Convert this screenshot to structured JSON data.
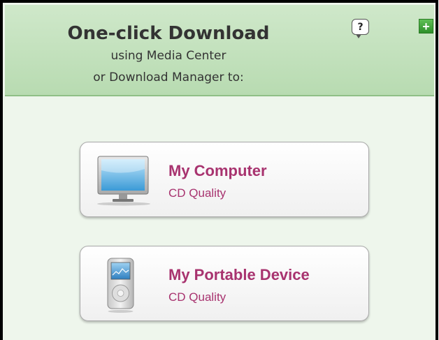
{
  "header": {
    "title": "One-click Download",
    "subtitle_line1": "using Media Center",
    "subtitle_line2": "or Download Manager to:",
    "help_label": "?",
    "expand_label": "+"
  },
  "options": [
    {
      "label": "My Computer",
      "quality": "CD Quality",
      "icon": "monitor-icon"
    },
    {
      "label": "My Portable Device",
      "quality": "CD Quality",
      "icon": "portable-player-icon"
    }
  ],
  "colors": {
    "header_bg": "#c4e2bd",
    "panel_bg": "#eef6ec",
    "option_text": "#a8336f",
    "accent_green": "#2e8f2a"
  }
}
